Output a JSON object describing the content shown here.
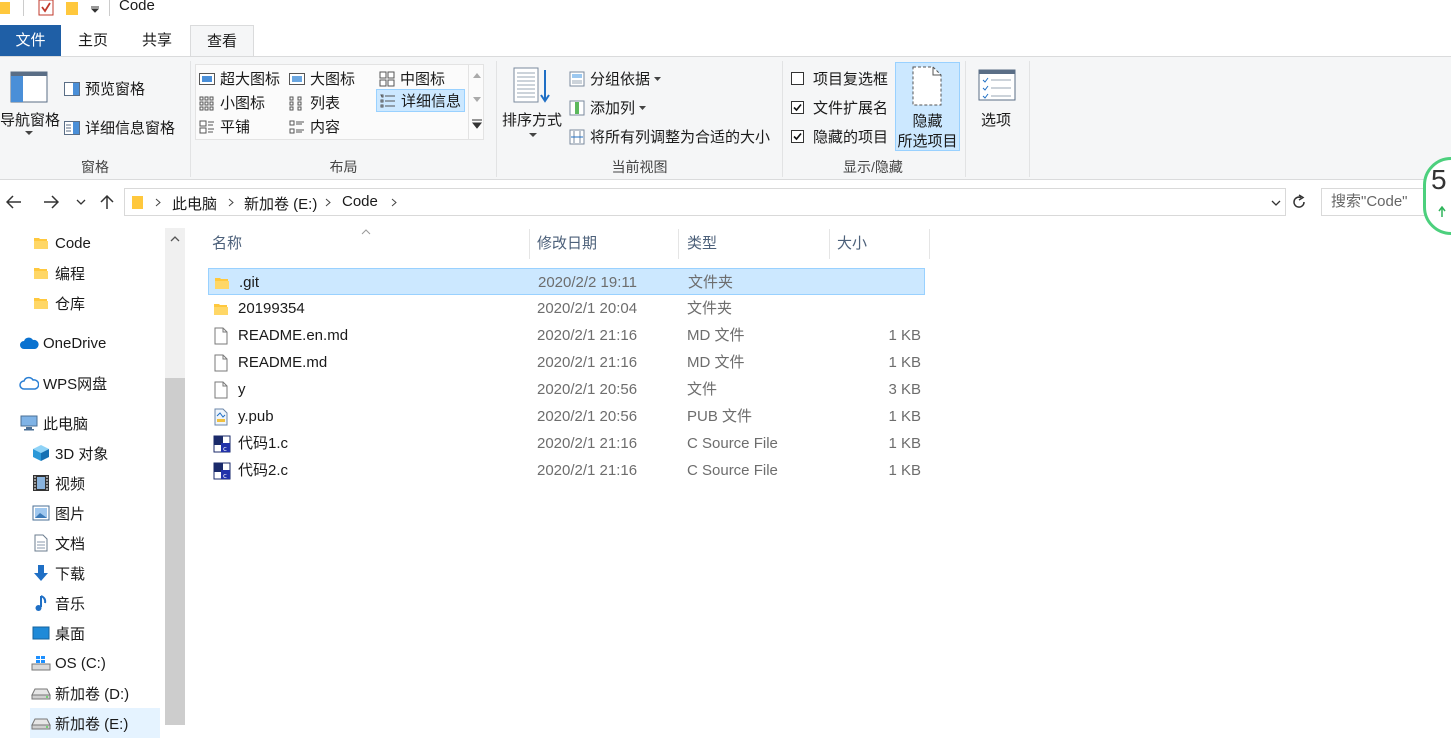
{
  "window": {
    "title": "Code"
  },
  "ribbon_tabs": [
    {
      "label": "文件",
      "active": false,
      "file": true
    },
    {
      "label": "主页",
      "active": false
    },
    {
      "label": "共享",
      "active": false
    },
    {
      "label": "查看",
      "active": true
    }
  ],
  "ribbon": {
    "panes": {
      "label": "窗格",
      "nav_pane": "导航窗格",
      "preview_pane": "预览窗格",
      "details_pane": "详细信息窗格"
    },
    "layout": {
      "label": "布局",
      "items": [
        "超大图标",
        "大图标",
        "中图标",
        "小图标",
        "列表",
        "详细信息",
        "平铺",
        "内容"
      ],
      "selected": "详细信息"
    },
    "current_view": {
      "label": "当前视图",
      "sort_by": "排序方式",
      "group_by": "分组依据",
      "add_column": "添加列",
      "size_all_columns": "将所有列调整为合适的大小"
    },
    "show_hide": {
      "label": "显示/隐藏",
      "item_checkboxes": {
        "label": "项目复选框",
        "checked": false
      },
      "file_extensions": {
        "label": "文件扩展名",
        "checked": true
      },
      "hidden_items": {
        "label": "隐藏的项目",
        "checked": true
      },
      "hide_selected_1": "隐藏",
      "hide_selected_2": "所选项目"
    },
    "options": {
      "label": "选项"
    }
  },
  "address_bar": {
    "crumbs": [
      "此电脑",
      "新加卷 (E:)",
      "Code"
    ],
    "search_placeholder": "搜索\"Code\""
  },
  "badge": {
    "text": "5"
  },
  "sidebar": {
    "items": [
      {
        "label": "Code",
        "icon": "folder-icon"
      },
      {
        "label": "编程",
        "icon": "folder-icon"
      },
      {
        "label": "仓库",
        "icon": "folder-icon"
      },
      {
        "label": "OneDrive",
        "icon": "cloud-icon"
      },
      {
        "label": "WPS网盘",
        "icon": "cloud-outline-icon"
      },
      {
        "label": "此电脑",
        "icon": "computer-icon"
      },
      {
        "label": "3D 对象",
        "icon": "cube-icon"
      },
      {
        "label": "视频",
        "icon": "film-icon"
      },
      {
        "label": "图片",
        "icon": "picture-icon"
      },
      {
        "label": "文档",
        "icon": "document-icon"
      },
      {
        "label": "下载",
        "icon": "download-icon"
      },
      {
        "label": "音乐",
        "icon": "music-icon"
      },
      {
        "label": "桌面",
        "icon": "desktop-icon"
      },
      {
        "label": "OS (C:)",
        "icon": "windows-drive-icon"
      },
      {
        "label": "新加卷 (D:)",
        "icon": "drive-icon"
      },
      {
        "label": "新加卷 (E:)",
        "icon": "drive-icon"
      }
    ]
  },
  "file_list": {
    "columns": [
      "名称",
      "修改日期",
      "类型",
      "大小"
    ],
    "rows": [
      {
        "name": ".git",
        "modified": "2020/2/2 19:11",
        "type": "文件夹",
        "size": "",
        "icon": "folder-icon",
        "selected": true
      },
      {
        "name": "20199354",
        "modified": "2020/2/1 20:04",
        "type": "文件夹",
        "size": "",
        "icon": "folder-icon"
      },
      {
        "name": "README.en.md",
        "modified": "2020/2/1 21:16",
        "type": "MD 文件",
        "size": "1 KB",
        "icon": "file-icon"
      },
      {
        "name": "README.md",
        "modified": "2020/2/1 21:16",
        "type": "MD 文件",
        "size": "1 KB",
        "icon": "file-icon"
      },
      {
        "name": "y",
        "modified": "2020/2/1 20:56",
        "type": "文件",
        "size": "3 KB",
        "icon": "file-icon"
      },
      {
        "name": "y.pub",
        "modified": "2020/2/1 20:56",
        "type": "PUB 文件",
        "size": "1 KB",
        "icon": "publisher-file-icon"
      },
      {
        "name": "代码1.c",
        "modified": "2020/2/1 21:16",
        "type": "C Source File",
        "size": "1 KB",
        "icon": "c-source-icon"
      },
      {
        "name": "代码2.c",
        "modified": "2020/2/1 21:16",
        "type": "C Source File",
        "size": "1 KB",
        "icon": "c-source-icon"
      }
    ]
  },
  "colors": {
    "file_tab": "#1f5fa6",
    "selection": "#cce8ff",
    "selection_border": "#99d1ff",
    "folder": "#ffc83d"
  }
}
